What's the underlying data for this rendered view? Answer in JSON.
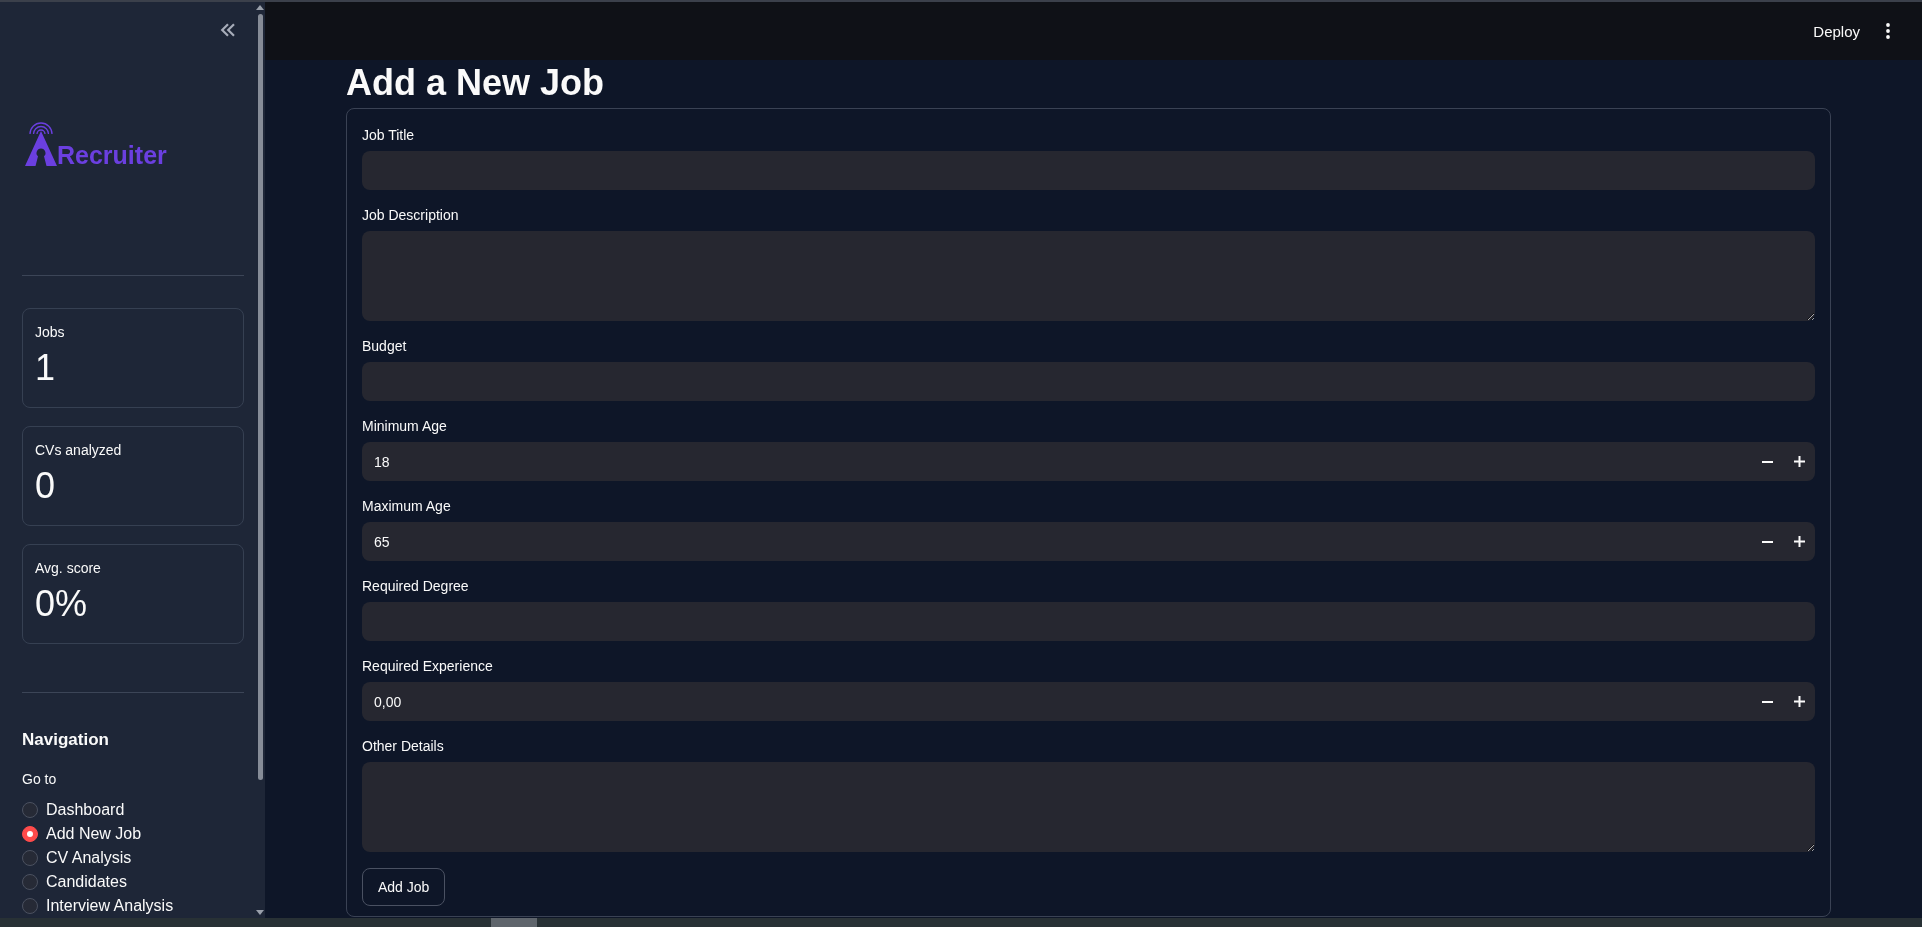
{
  "sidebar": {
    "logo": {
      "text": "Recruiter"
    },
    "metrics": [
      {
        "label": "Jobs",
        "value": "1"
      },
      {
        "label": "CVs analyzed",
        "value": "0"
      },
      {
        "label": "Avg. score",
        "value": "0%"
      }
    ],
    "navigation": {
      "heading": "Navigation",
      "group_label": "Go to",
      "options": [
        {
          "label": "Dashboard",
          "selected": false
        },
        {
          "label": "Add New Job",
          "selected": true
        },
        {
          "label": "CV Analysis",
          "selected": false
        },
        {
          "label": "Candidates",
          "selected": false
        },
        {
          "label": "Interview Analysis",
          "selected": false
        }
      ]
    }
  },
  "header": {
    "deploy_button": "Deploy"
  },
  "form": {
    "title": "Add a New Job",
    "fields": [
      {
        "kind": "text",
        "label": "Job Title"
      },
      {
        "kind": "textarea",
        "label": "Job Description"
      },
      {
        "kind": "text",
        "label": "Budget"
      },
      {
        "kind": "number",
        "label": "Minimum Age",
        "value": "18"
      },
      {
        "kind": "number",
        "label": "Maximum Age",
        "value": "65"
      },
      {
        "kind": "text",
        "label": "Required Degree"
      },
      {
        "kind": "number",
        "label": "Required Experience",
        "value": "0,00"
      },
      {
        "kind": "textarea",
        "label": "Other Details"
      }
    ],
    "submit_button": "Add Job"
  }
}
